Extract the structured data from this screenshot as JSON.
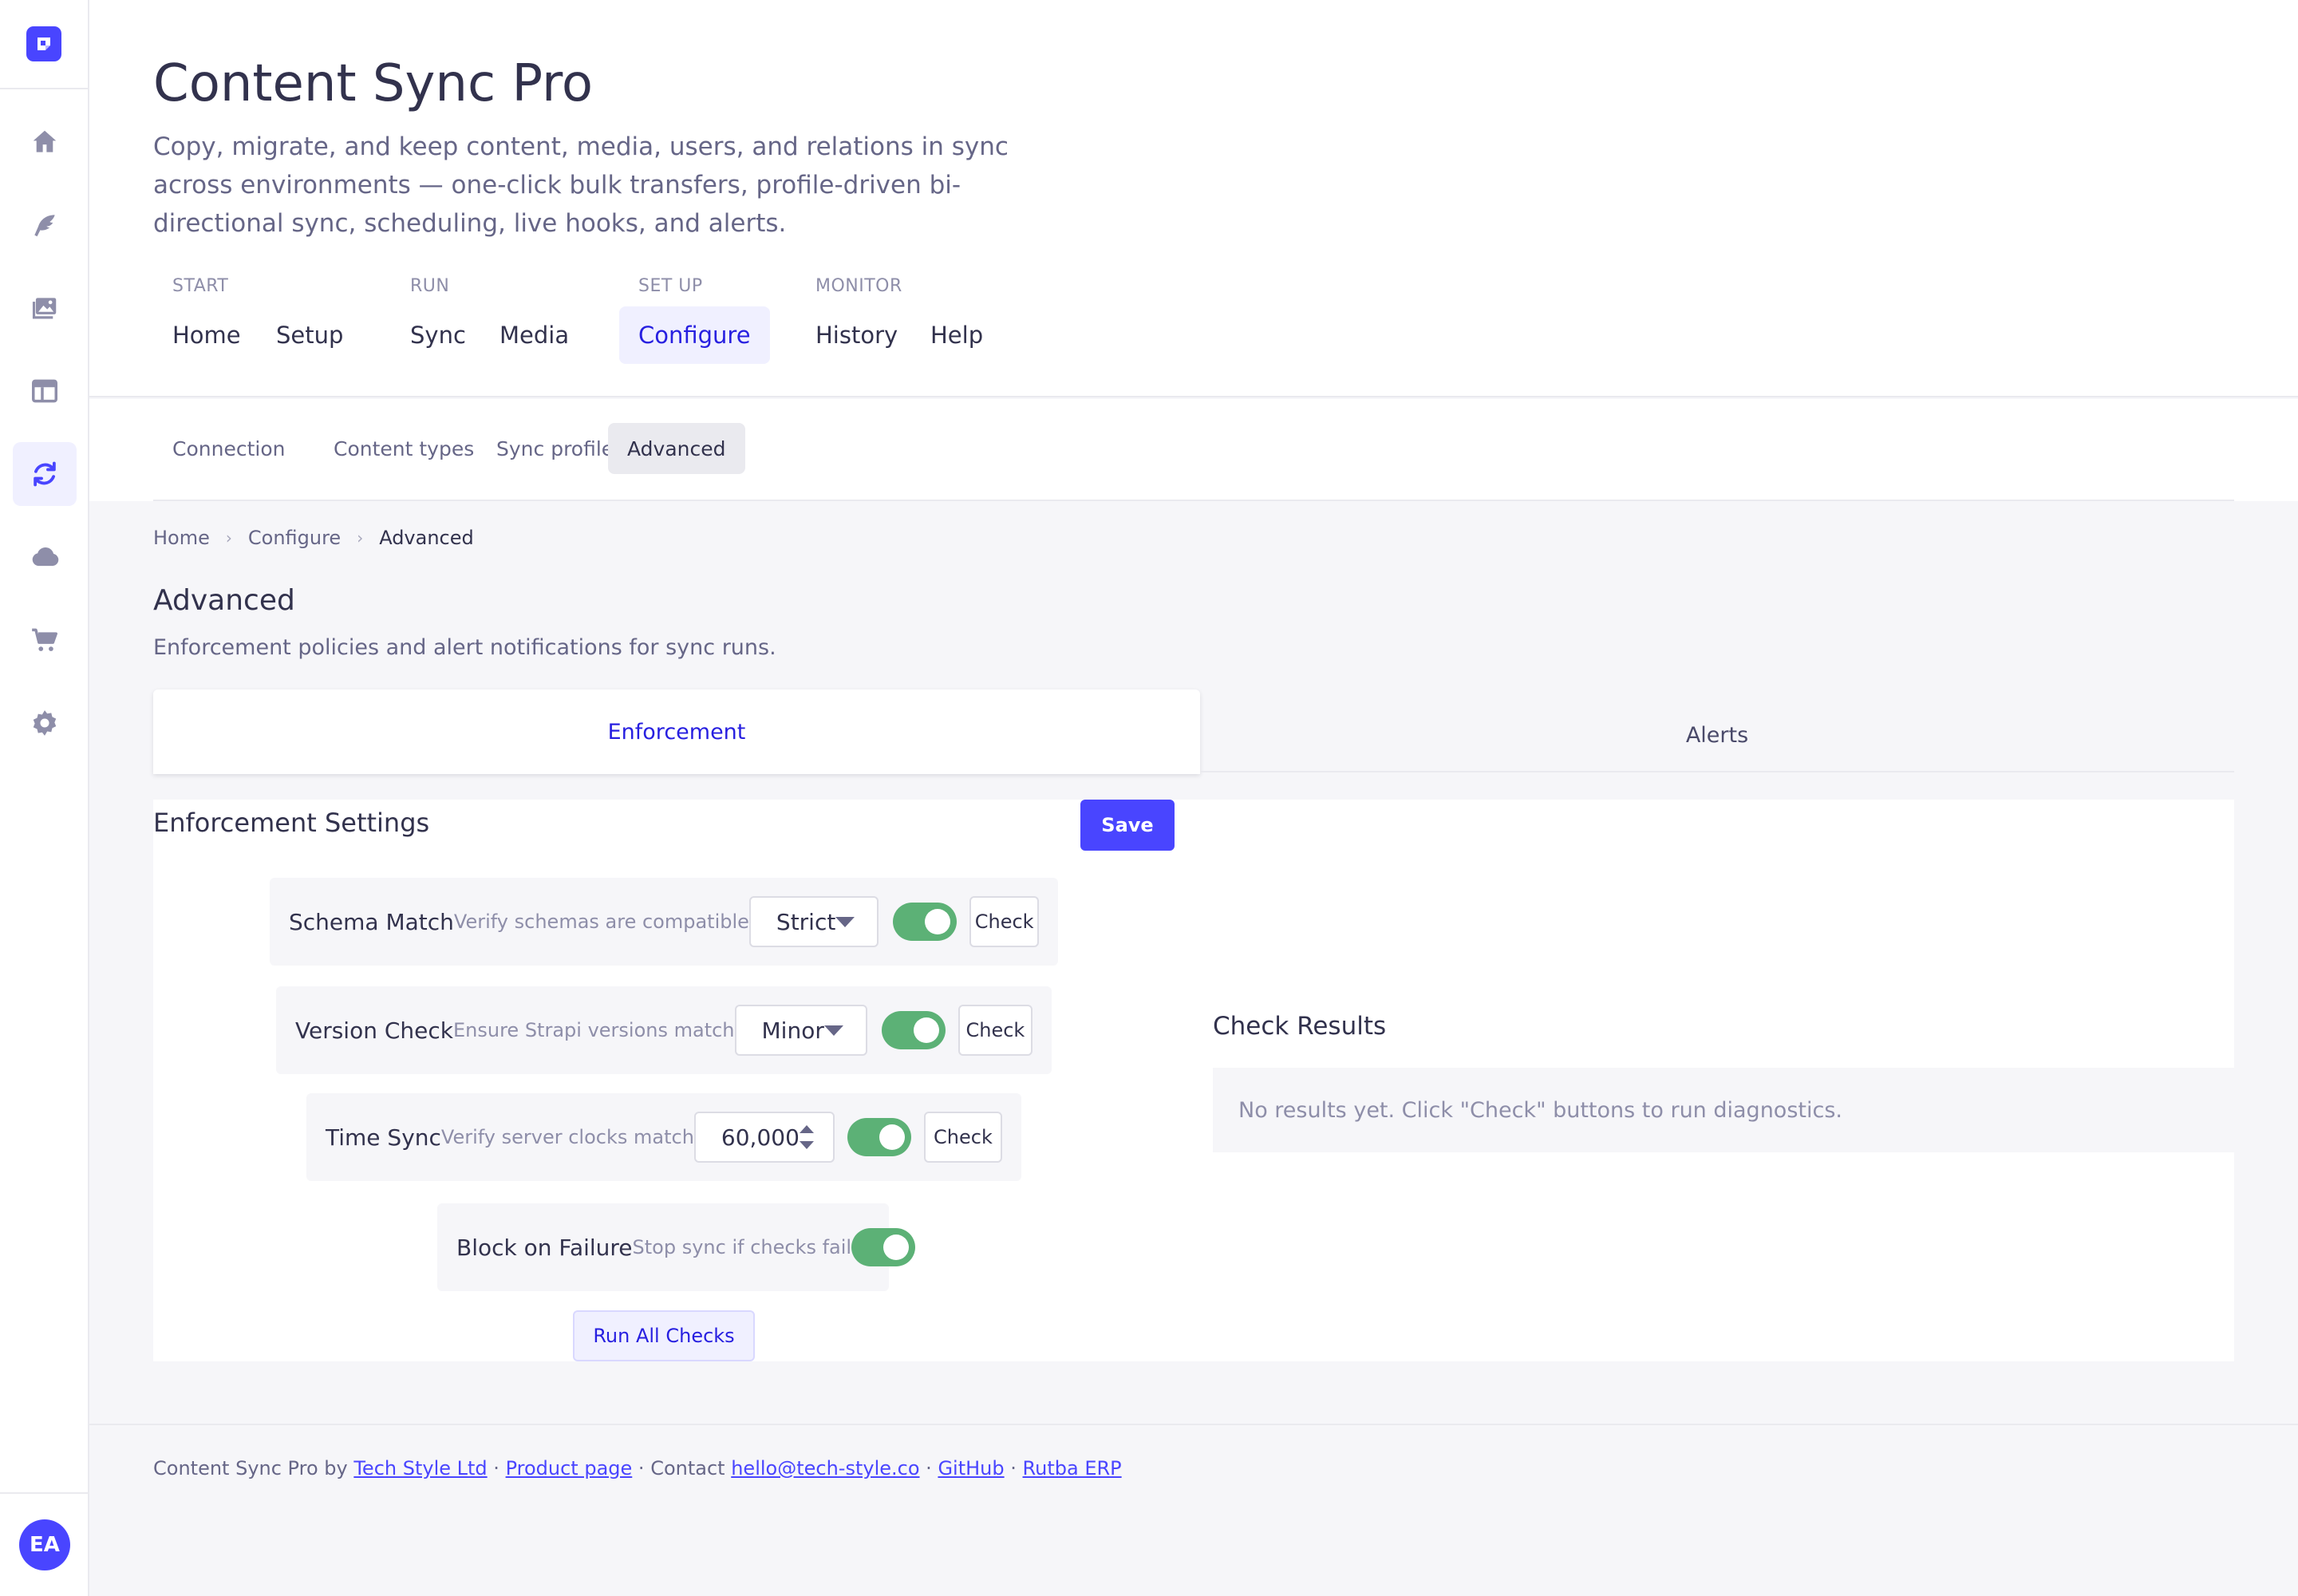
{
  "app": {
    "title": "Content Sync Pro",
    "description": "Copy, migrate, and keep content, media, users, and relations in sync across environments — one-click bulk transfers, profile-driven bi-directional sync, scheduling, live hooks, and alerts.",
    "user_initials": "EA",
    "accent_color": "#4945ff"
  },
  "sidebar": {
    "icons": [
      "home-icon",
      "feather-icon",
      "media-library-icon",
      "layout-icon",
      "sync-icon",
      "cloud-icon",
      "cart-icon",
      "settings-icon"
    ],
    "active": "sync-icon"
  },
  "nav": {
    "groups": [
      {
        "label": "START",
        "links": [
          "Home",
          "Setup"
        ]
      },
      {
        "label": "RUN",
        "links": [
          "Sync",
          "Media"
        ]
      },
      {
        "label": "SET UP",
        "links": [
          "Configure"
        ]
      },
      {
        "label": "MONITOR",
        "links": [
          "History",
          "Help"
        ]
      }
    ],
    "active": "Configure"
  },
  "subtabs": {
    "items": [
      "Connection",
      "Content types",
      "Sync profiles",
      "Advanced"
    ],
    "active": "Advanced"
  },
  "breadcrumb": [
    "Home",
    "Configure",
    "Advanced"
  ],
  "section": {
    "title": "Advanced",
    "description": "Enforcement policies and alert notifications for sync runs."
  },
  "tabs": {
    "enforcement": "Enforcement",
    "alerts": "Alerts",
    "active": "Enforcement"
  },
  "enforcement": {
    "title": "Enforcement Settings",
    "save_label": "Save",
    "check_label": "Check",
    "run_all_label": "Run All Checks",
    "rows": {
      "schema": {
        "label": "Schema Match",
        "hint": "Verify schemas are compatible",
        "select": "Strict",
        "enabled": true
      },
      "version": {
        "label": "Version Check",
        "hint": "Ensure Strapi versions match",
        "select": "Minor",
        "enabled": true
      },
      "time": {
        "label": "Time Sync",
        "hint": "Verify server clocks match",
        "value": "60,000",
        "enabled": true
      },
      "block": {
        "label": "Block on Failure",
        "hint": "Stop sync if checks fail",
        "enabled": true
      }
    }
  },
  "results": {
    "title": "Check Results",
    "empty_text": "No results yet. Click \"Check\" buttons to run diagnostics."
  },
  "footer": {
    "prefix": "Content Sync Pro by",
    "company": "Tech Style Ltd",
    "sep": "·",
    "product_page": "Product page",
    "contact_label": "Contact",
    "email": "hello@tech-style.co",
    "github": "GitHub",
    "rutba": "Rutba ERP"
  }
}
